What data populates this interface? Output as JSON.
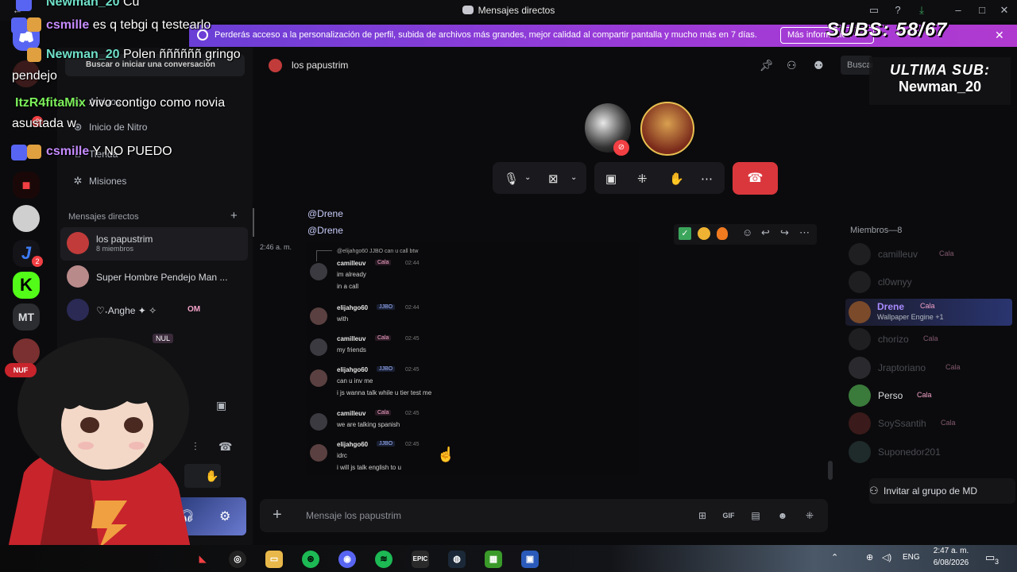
{
  "window": {
    "title": "Mensajes directos"
  },
  "banner": {
    "text": "Perderás acceso a la personalización de perfil, subida de archivos más grandes, mejor calidad al compartir pantalla y mucho más en 7 días.",
    "button": "Más información"
  },
  "rail": {
    "mt_label": "MT",
    "badges": [
      "2",
      "2"
    ]
  },
  "sidebar": {
    "search_placeholder": "Buscar o iniciar una conversación",
    "nav": [
      "Amigos",
      "Inicio de Nitro",
      "Tienda",
      "Misiones"
    ],
    "dm_header": "Mensajes directos",
    "dms": [
      {
        "name": "los papustrim",
        "sub": "8 miembros"
      },
      {
        "name": "Super Hombre Pendejo Man ..."
      },
      {
        "name": "♡˖Anghe ✦ ✧",
        "tag": "OM"
      },
      {
        "name": "",
        "tag": "NUL"
      }
    ]
  },
  "header": {
    "channel": "los papustrim",
    "search_placeholder": "Buscar"
  },
  "messages": {
    "mentions": [
      "@Drene",
      "@Drene"
    ],
    "timestamp": "2:46 a. m.",
    "embed_reply": "@elijahgo60  JJBO can u call btw",
    "embed": [
      {
        "user": "camilleuv",
        "tag": "Cala",
        "time": "02:44",
        "lines": [
          "im already",
          "in a call"
        ]
      },
      {
        "user": "elijahgo60",
        "tag": "JJBO",
        "time": "02:44",
        "lines": [
          "with"
        ]
      },
      {
        "user": "camilleuv",
        "tag": "Cala",
        "time": "02:45",
        "lines": [
          "my friends"
        ]
      },
      {
        "user": "elijahgo60",
        "tag": "JJBO",
        "time": "02:45",
        "lines": [
          "can u inv me",
          "i js wanna talk while u tier test me"
        ]
      },
      {
        "user": "camilleuv",
        "tag": "Cala",
        "time": "02:45",
        "lines": [
          "we are talking spanish"
        ]
      },
      {
        "user": "elijahgo60",
        "tag": "JJBO",
        "time": "02:45",
        "lines": [
          "idrc",
          "i will js talk english to u"
        ]
      }
    ]
  },
  "composer": {
    "placeholder": "Mensaje los papustrim"
  },
  "members": {
    "header": "Miembros—8",
    "list": [
      {
        "name": "camilleuv",
        "tag": "Cala",
        "color": "#5d5f66"
      },
      {
        "name": "cl0wnyy",
        "tag": "",
        "color": "#5d5f66"
      },
      {
        "name": "Drene",
        "tag": "Cala",
        "color": "#a98bff",
        "activity": "Wallpaper Engine +1"
      },
      {
        "name": "chorizo",
        "tag": "Cala",
        "color": "#5d5f66"
      },
      {
        "name": "Jraptoriano",
        "tag": "Cala",
        "color": "#5d5f66"
      },
      {
        "name": "Perso",
        "tag": "Cala",
        "color": "#dbdee1"
      },
      {
        "name": "SoySsantih",
        "tag": "Cala",
        "color": "#5d5f66"
      },
      {
        "name": "Suponedor201",
        "tag": "",
        "color": "#5d5f66"
      }
    ],
    "invite": "Invitar al grupo de MD"
  },
  "stream": {
    "subs": "SUBS: 58/67",
    "last_sub_title": "ULTIMA SUB:",
    "last_sub_name": "Newman_20",
    "chat": [
      {
        "user": "Newman_20",
        "msg": "Cu"
      },
      {
        "user": "csmille",
        "msg": "es q tebgi q testearlo"
      },
      {
        "user": "Newman_20",
        "msg": "Polen ññññññ gringo"
      },
      {
        "user": "",
        "msg": "pendejo"
      },
      {
        "user": "ItzR4fitaMix",
        "msg": "vivo contigo como novia"
      },
      {
        "user": "",
        "msg": "asustada w"
      },
      {
        "user": "csmille",
        "msg": "Y NO PUEDO"
      }
    ]
  },
  "taskbar": {
    "lang": "ENG",
    "time": "2:47 a. m.",
    "date": "6/08/2026",
    "notif_count": "3"
  }
}
